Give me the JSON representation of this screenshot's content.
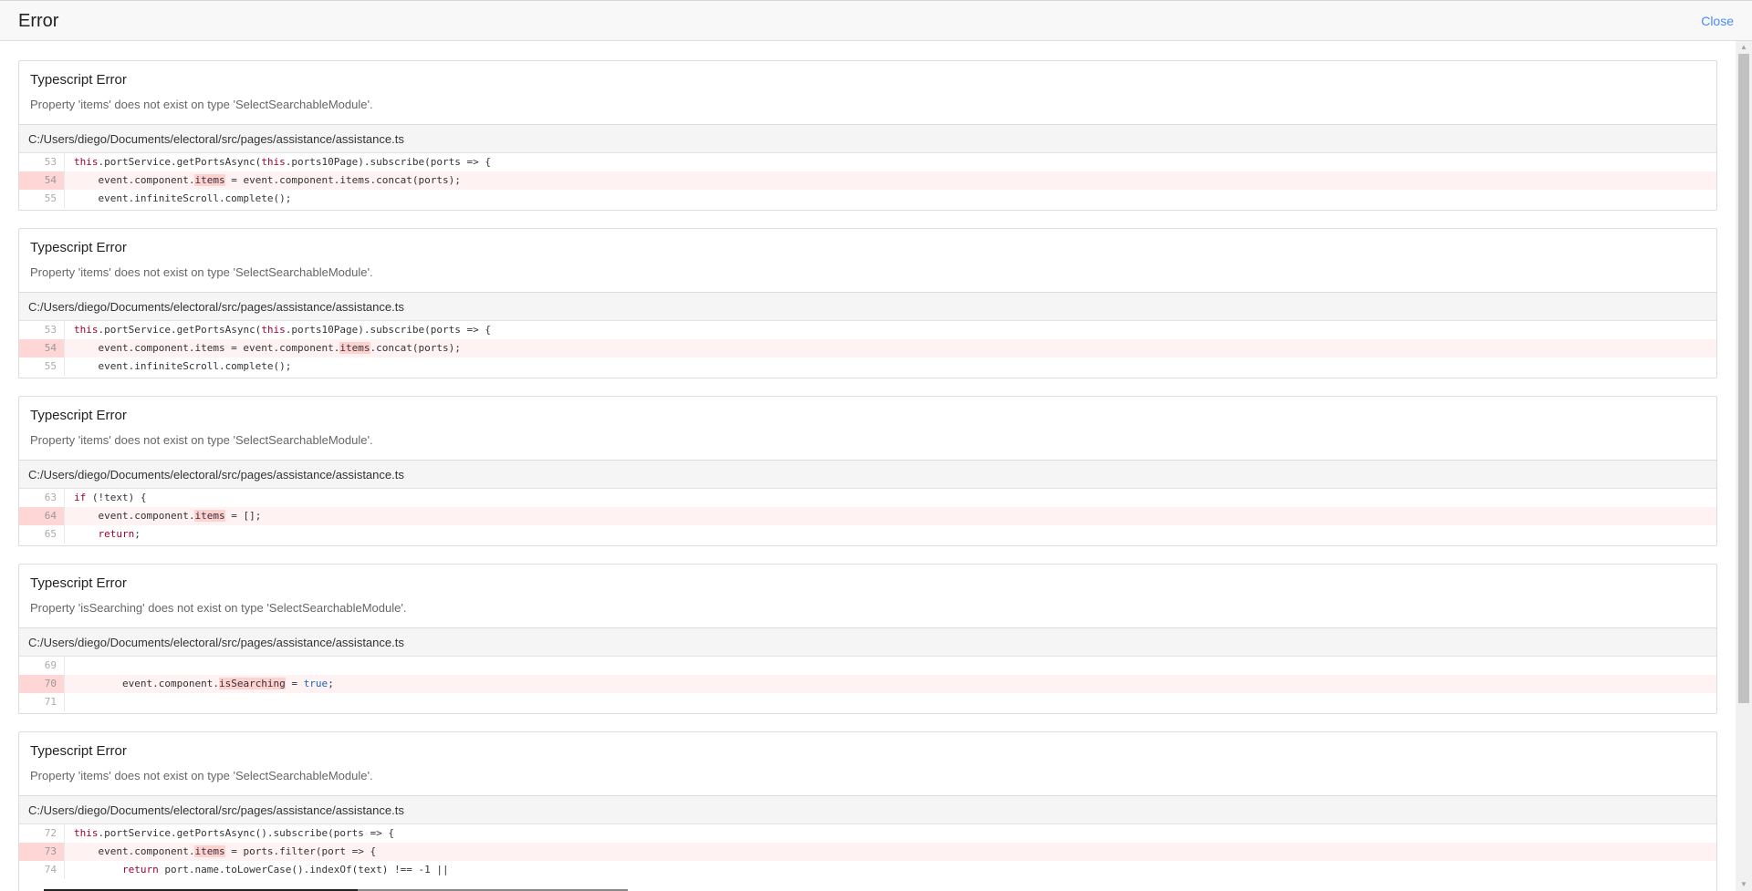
{
  "header": {
    "title": "Error",
    "close_label": "Close"
  },
  "errors": [
    {
      "title": "Typescript Error",
      "message": "Property 'items' does not exist on type 'SelectSearchableModule'.",
      "file": "C:/Users/diego/Documents/electoral/src/pages/assistance/assistance.ts",
      "lines": [
        {
          "num": "53",
          "pre": "",
          "kw": "this",
          "mid": ".portService.getPortsAsync(",
          "kw2": "this",
          "post": ".ports10Page).subscribe(ports => {",
          "mark": "",
          "tail": ""
        },
        {
          "num": "54",
          "pre": "    event.component.",
          "mark": "items",
          "tail": " = event.component.items.concat(ports);"
        },
        {
          "num": "55",
          "pre": "    event.infiniteScroll.complete();",
          "mark": "",
          "tail": ""
        }
      ]
    },
    {
      "title": "Typescript Error",
      "message": "Property 'items' does not exist on type 'SelectSearchableModule'.",
      "file": "C:/Users/diego/Documents/electoral/src/pages/assistance/assistance.ts",
      "lines": [
        {
          "num": "53",
          "pre": "",
          "kw": "this",
          "mid": ".portService.getPortsAsync(",
          "kw2": "this",
          "post": ".ports10Page).subscribe(ports => {"
        },
        {
          "num": "54",
          "pre": "    event.component.items = event.component.",
          "mark": "items",
          "tail": ".concat(ports);"
        },
        {
          "num": "55",
          "pre": "    event.infiniteScroll.complete();",
          "mark": "",
          "tail": ""
        }
      ]
    },
    {
      "title": "Typescript Error",
      "message": "Property 'items' does not exist on type 'SelectSearchableModule'.",
      "file": "C:/Users/diego/Documents/electoral/src/pages/assistance/assistance.ts",
      "lines": [
        {
          "num": "63",
          "kwlead": "if",
          "pre": " (!text) {",
          "mark": "",
          "tail": ""
        },
        {
          "num": "64",
          "pre": "    event.component.",
          "mark": "items",
          "tail": " = [];"
        },
        {
          "num": "65",
          "pre": "    ",
          "kwlead": "return",
          "tail": ";"
        }
      ]
    },
    {
      "title": "Typescript Error",
      "message": "Property 'isSearching' does not exist on type 'SelectSearchableModule'.",
      "file": "C:/Users/diego/Documents/electoral/src/pages/assistance/assistance.ts",
      "lines": [
        {
          "num": "69",
          "pre": "",
          "mark": "",
          "tail": ""
        },
        {
          "num": "70",
          "pre": "        event.component.",
          "mark": "isSearching",
          "tail": " = ",
          "bool": "true",
          "end": ";"
        },
        {
          "num": "71",
          "pre": "",
          "mark": "",
          "tail": ""
        }
      ]
    },
    {
      "title": "Typescript Error",
      "message": "Property 'items' does not exist on type 'SelectSearchableModule'.",
      "file": "C:/Users/diego/Documents/electoral/src/pages/assistance/assistance.ts",
      "lines": [
        {
          "num": "72",
          "pre": "",
          "kw": "this",
          "mid": ".portService.getPortsAsync().subscribe(ports => {"
        },
        {
          "num": "73",
          "pre": "    event.component.",
          "mark": "items",
          "tail": " = ports.filter(port => {"
        },
        {
          "num": "74",
          "pre": "        ",
          "kwlead": "return",
          "tail": " port.name.toLowerCase().indexOf(text) !== -1 ||"
        }
      ]
    }
  ]
}
